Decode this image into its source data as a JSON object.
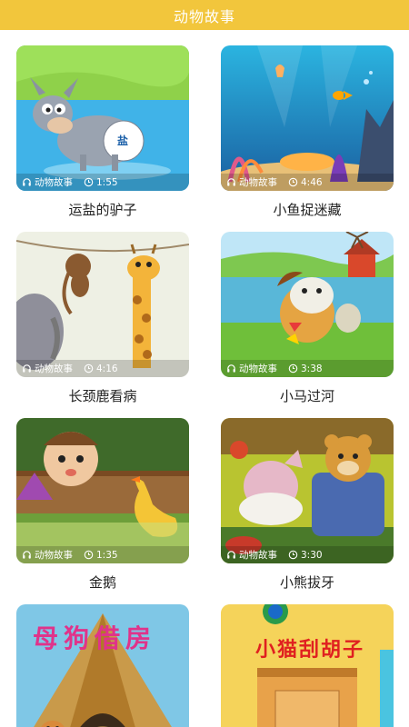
{
  "header": {
    "title": "动物故事"
  },
  "items": [
    {
      "title": "运盐的驴子",
      "category": "动物故事",
      "duration": "1:55"
    },
    {
      "title": "小鱼捉迷藏",
      "category": "动物故事",
      "duration": "4:46"
    },
    {
      "title": "长颈鹿看病",
      "category": "动物故事",
      "duration": "4:16"
    },
    {
      "title": "小马过河",
      "category": "动物故事",
      "duration": "3:38"
    },
    {
      "title": "金鹅",
      "category": "动物故事",
      "duration": "1:35"
    },
    {
      "title": "小熊拔牙",
      "category": "动物故事",
      "duration": "3:30"
    },
    {
      "title": "",
      "category": "",
      "duration": ""
    },
    {
      "title": "",
      "category": "",
      "duration": ""
    }
  ],
  "art_text": {
    "salt_label": "盐",
    "dog_story": "母狗借房",
    "cat_story": "小猫刮胡子"
  },
  "colors": {
    "header": "#f2c63c",
    "caption": "#222222"
  }
}
